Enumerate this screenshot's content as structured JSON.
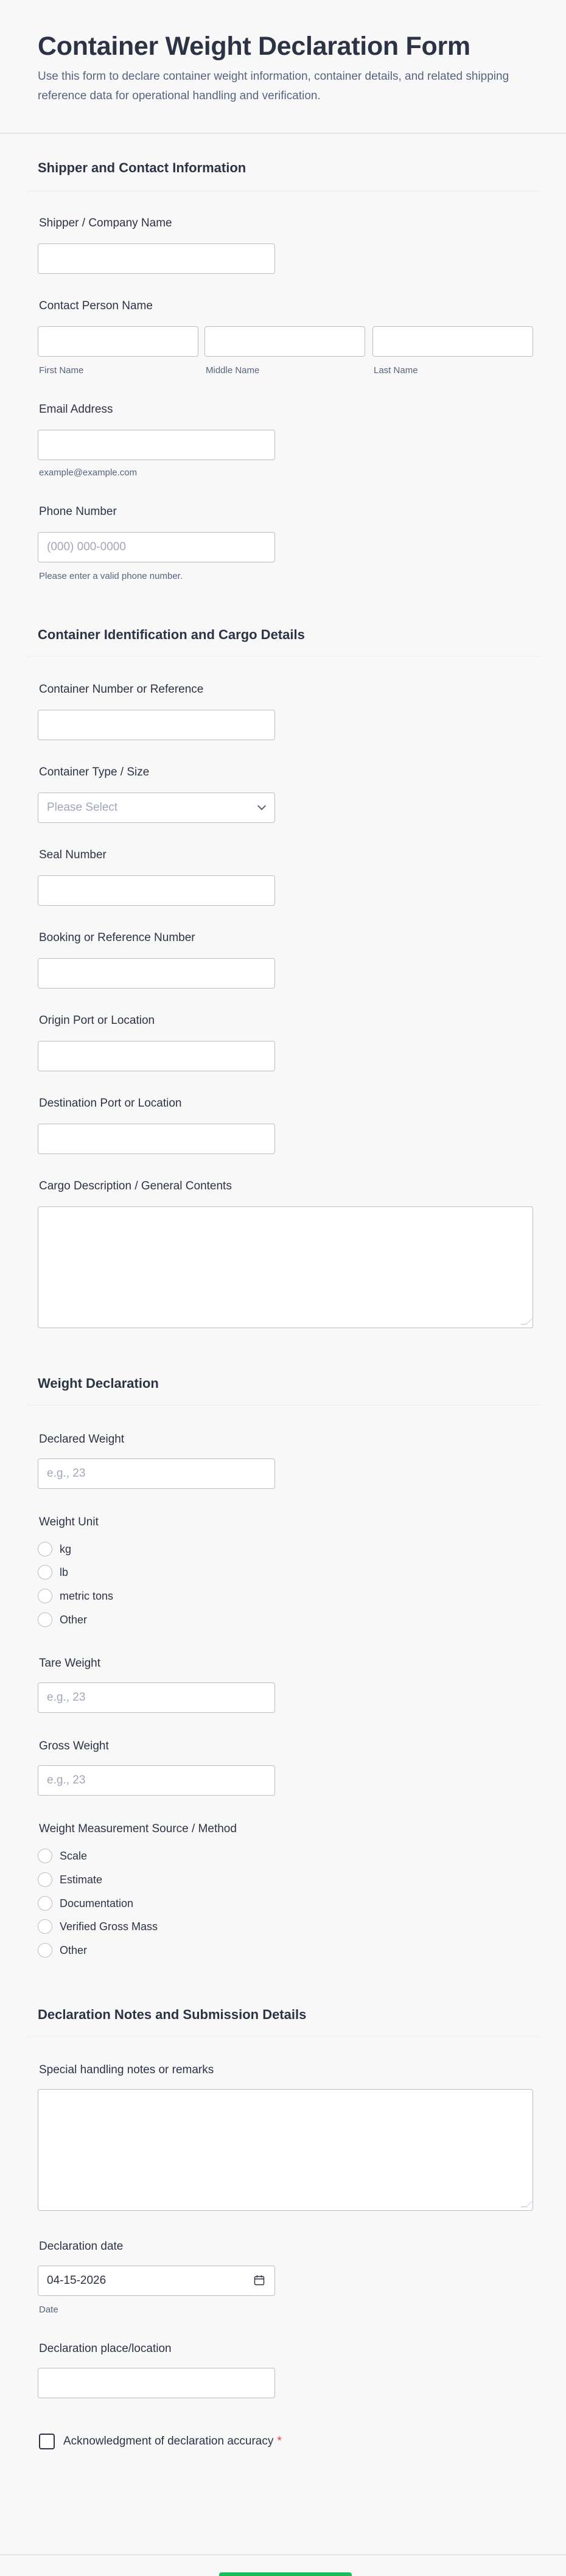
{
  "form": {
    "title": "Container Weight Declaration Form",
    "subtitle": "Use this form to declare container weight information, container details, and related shipping reference data for operational handling and verification."
  },
  "sections": {
    "shipper": "Shipper and Contact Information",
    "container": "Container Identification and Cargo Details",
    "weight": "Weight Declaration",
    "notes": "Declaration Notes and Submission Details"
  },
  "fields": {
    "company": {
      "label": "Shipper / Company Name",
      "value": ""
    },
    "contact": {
      "label": "Contact Person Name",
      "first": "First Name",
      "middle": "Middle Name",
      "last": "Last Name"
    },
    "email": {
      "label": "Email Address",
      "sublabel": "example@example.com",
      "value": ""
    },
    "phone": {
      "label": "Phone Number",
      "placeholder": "(000) 000-0000",
      "sublabel": "Please enter a valid phone number."
    },
    "container_number": {
      "label": "Container Number or Reference"
    },
    "container_type": {
      "label": "Container Type / Size",
      "selected": "Please Select"
    },
    "seal": {
      "label": "Seal Number"
    },
    "booking": {
      "label": "Booking or Reference Number"
    },
    "origin": {
      "label": "Origin Port or Location"
    },
    "destination": {
      "label": "Destination Port or Location"
    },
    "cargo": {
      "label": "Cargo Description / General Contents"
    },
    "declared_weight": {
      "label": "Declared Weight",
      "placeholder": "e.g., 23"
    },
    "weight_unit": {
      "label": "Weight Unit",
      "options": [
        "kg",
        "lb",
        "metric tons",
        "Other"
      ]
    },
    "tare_weight": {
      "label": "Tare Weight",
      "placeholder": "e.g., 23"
    },
    "gross_weight": {
      "label": "Gross Weight",
      "placeholder": "e.g., 23"
    },
    "method": {
      "label": "Weight Measurement Source / Method",
      "options": [
        "Scale",
        "Estimate",
        "Documentation",
        "Verified Gross Mass",
        "Other"
      ]
    },
    "remarks": {
      "label": "Special handling notes or remarks"
    },
    "declaration_date": {
      "label": "Declaration date",
      "value": "04-15-2026",
      "sublabel": "Date"
    },
    "declaration_place": {
      "label": "Declaration place/location"
    },
    "acknowledgment": {
      "label": "Acknowledgment of declaration accuracy",
      "required_mark": "*"
    }
  },
  "icons": {
    "dropdown": "chevron-down-icon",
    "calendar": "calendar-icon"
  },
  "colors": {
    "submit": "#18bd5b",
    "required": "#f23a3c"
  }
}
